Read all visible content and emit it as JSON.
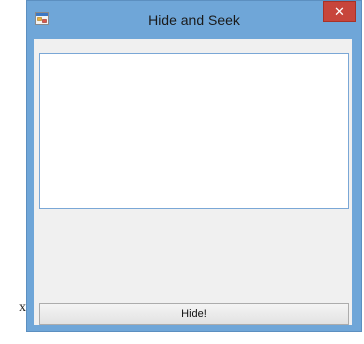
{
  "window": {
    "title": "Hide and Seek",
    "app_icon": "winforms-app-icon",
    "close_label": "✕",
    "close_icon": "close-icon"
  },
  "main": {
    "list_items": [],
    "hide_button_label": "Hide!"
  },
  "background": {
    "stray_char": "x"
  },
  "colors": {
    "frame": "#6fa6d8",
    "close": "#c7453b",
    "client": "#f0f0f0",
    "list_border": "#7aa7d6"
  }
}
